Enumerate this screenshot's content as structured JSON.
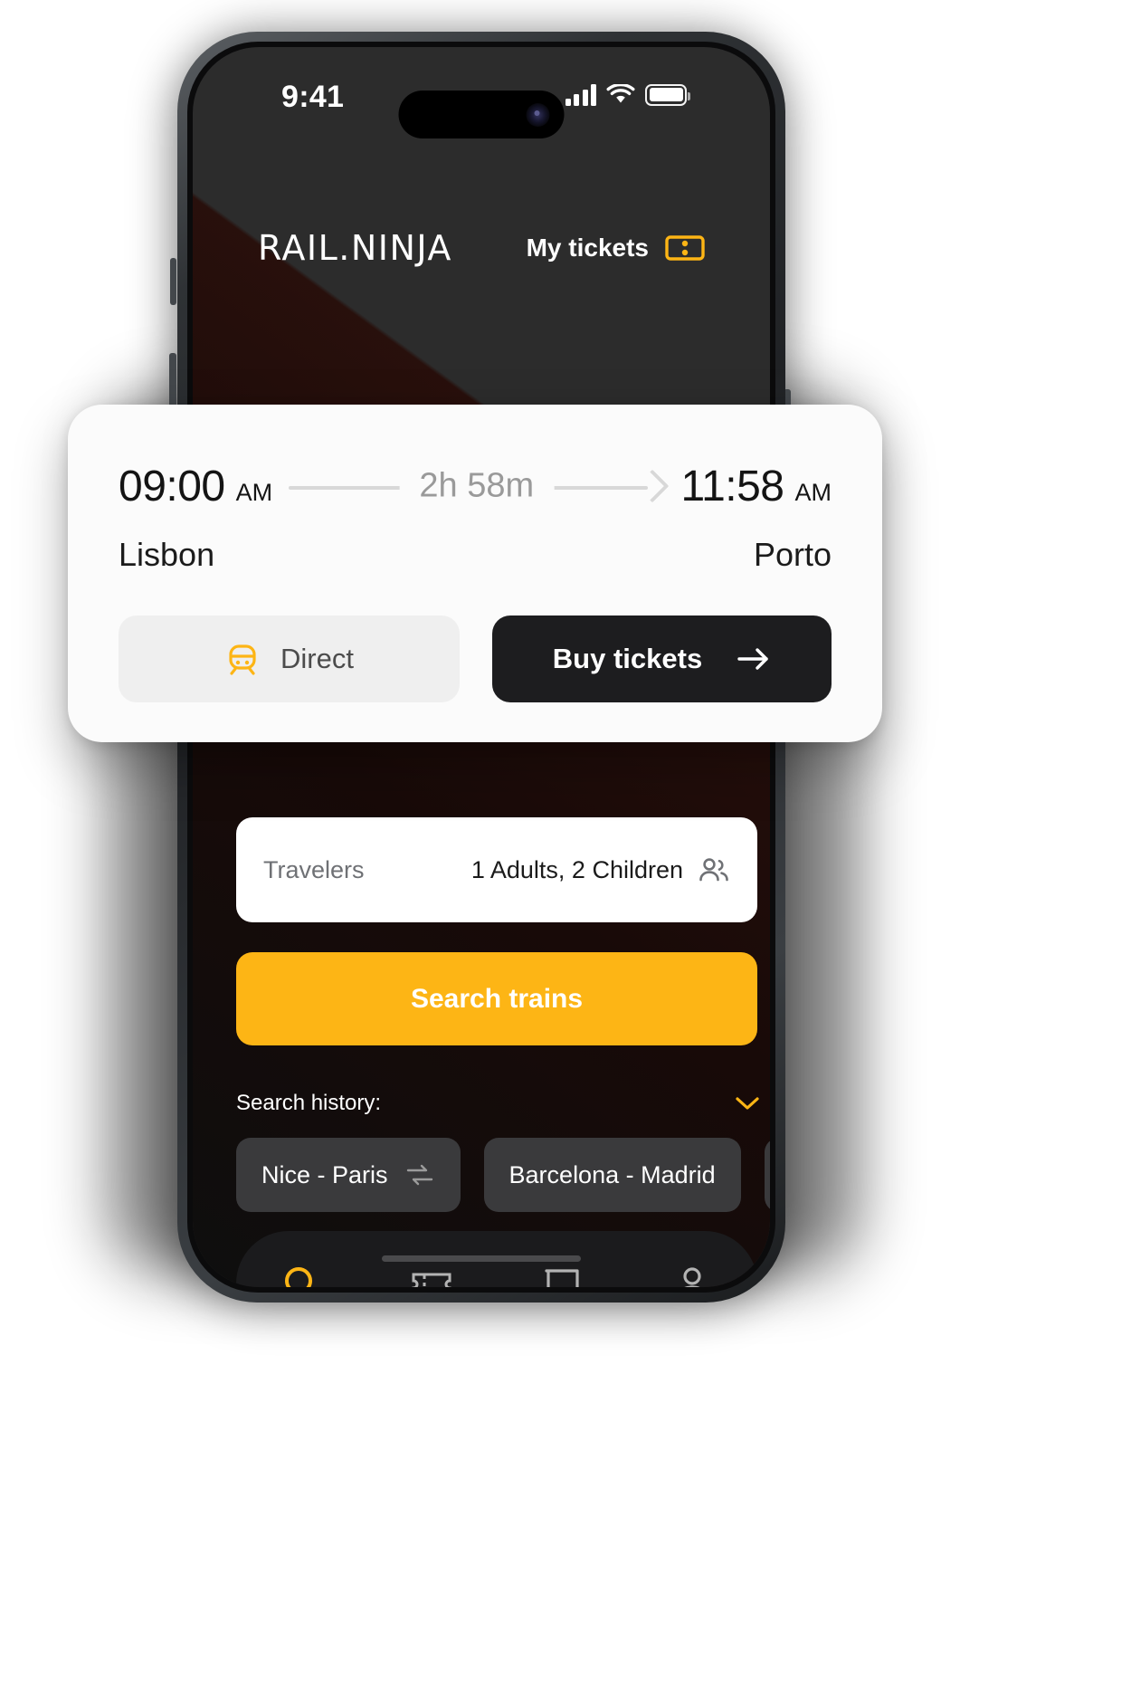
{
  "status_bar": {
    "time": "9:41",
    "icons": [
      "cellular-signal-icon",
      "wifi-icon",
      "battery-icon"
    ]
  },
  "app_header": {
    "logo": "RAIL.NINJA",
    "my_tickets_label": "My tickets",
    "ticket_icon": "ticket-icon"
  },
  "journey_card": {
    "depart_time": "09:00",
    "depart_ampm": "AM",
    "duration": "2h 58m",
    "arrive_time": "11:58",
    "arrive_ampm": "AM",
    "origin": "Lisbon",
    "destination": "Porto",
    "direct_label": "Direct",
    "direct_icon": "train-icon",
    "buy_label": "Buy tickets",
    "buy_icon": "arrow-right-icon"
  },
  "travelers": {
    "label": "Travelers",
    "value": "1 Adults, 2 Children",
    "icon": "people-icon"
  },
  "search": {
    "button_label": "Search trains"
  },
  "history": {
    "label": "Search history:",
    "chevron_icon": "chevron-down-icon",
    "chips": [
      {
        "label": "Nice - Paris",
        "icon": "swap-icon"
      },
      {
        "label": "Barcelona - Madrid",
        "icon": "swap-icon"
      },
      {
        "label": "",
        "icon": "swap-icon"
      }
    ]
  },
  "tabbar": {
    "items": [
      {
        "name": "search",
        "icon": "search-icon",
        "active": true
      },
      {
        "name": "tickets",
        "icon": "ticket-icon",
        "active": false
      },
      {
        "name": "chat",
        "icon": "chat-icon",
        "active": false
      },
      {
        "name": "profile",
        "icon": "person-icon",
        "active": false
      }
    ]
  },
  "colors": {
    "accent": "#FDB515",
    "dark_screen": "#2c2c2c",
    "dark_panel": "#1b1b1d",
    "card_bg": "#fbfbfb",
    "buy_button": "#1d1d1f"
  }
}
